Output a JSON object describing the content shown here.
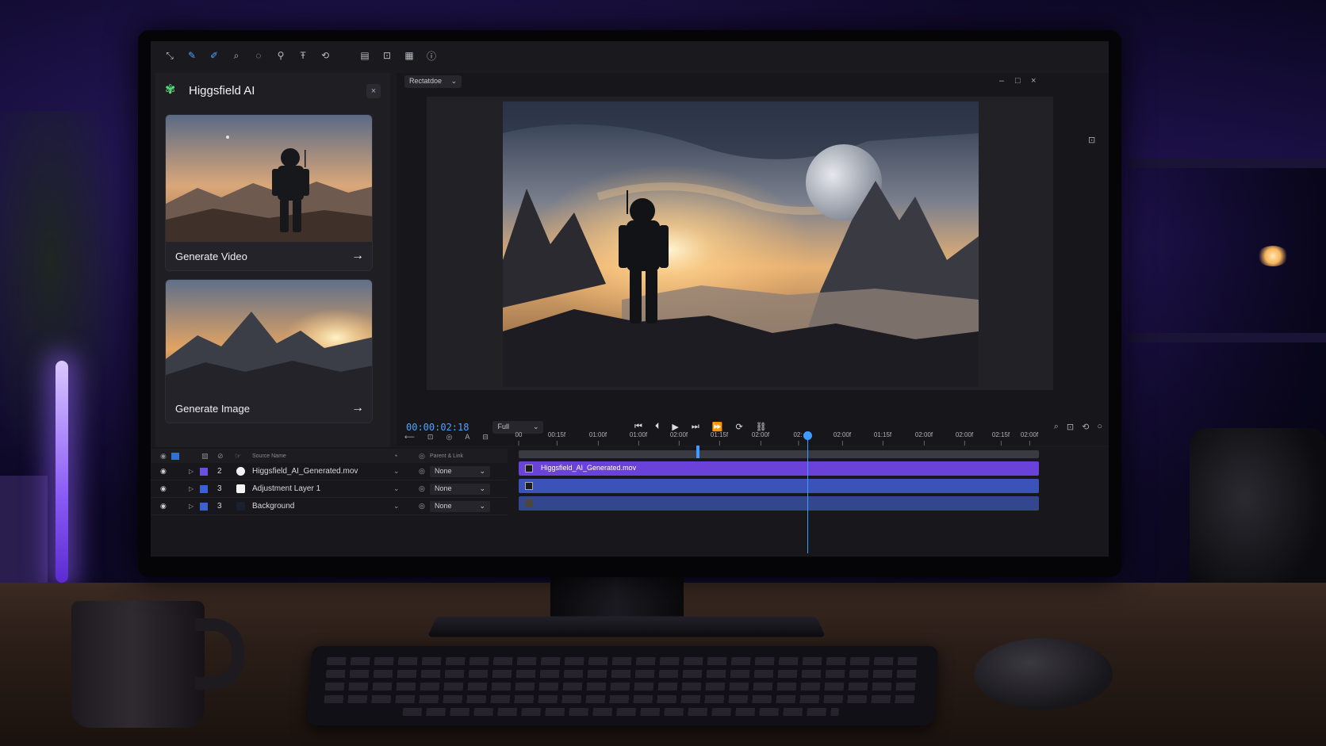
{
  "toolbar": {
    "icons": [
      "selection-tool-icon",
      "pen-tool-icon",
      "brush-tool-icon",
      "zoom-tool-icon",
      "lasso-tool-icon",
      "puppet-tool-icon",
      "text-tool-icon",
      "transform-tool-icon",
      "comment-icon",
      "crop-icon",
      "grid-icon",
      "info-icon"
    ],
    "glyphs": [
      "⤡",
      "✎",
      "✐",
      "⌕",
      "◌",
      "⚲",
      "Ŧ",
      "⟲",
      "▤",
      "⊡",
      "▦",
      "ⓘ"
    ]
  },
  "ai_panel": {
    "title": "Higgsfield AI",
    "close_glyph": "×",
    "cards": [
      {
        "label": "Generate Video",
        "arrow": "→"
      },
      {
        "label": "Generate Image",
        "arrow": "→"
      }
    ]
  },
  "viewer": {
    "composition_name": "Rectatdoe",
    "select_chevron": "⌄",
    "timecode": "00:00:02:18",
    "resolution": "Full",
    "transport_glyphs": [
      "⏮",
      "⏴",
      "▶",
      "⏭",
      "⏩",
      "⟳",
      "⛓"
    ],
    "tool_glyphs": [
      "⌕",
      "⊡",
      "⟲",
      "○"
    ],
    "window_glyphs": [
      "–",
      "□",
      "×"
    ]
  },
  "timeline": {
    "column_source_name": "Source Name",
    "column_parent": "Parent & Link",
    "ruler_ticks": [
      "00:15f",
      "01:00f",
      "01:00f",
      "02:00f",
      "01:15f",
      "02:00f",
      "02:",
      "02:00f",
      "01:15f",
      "02:00f",
      "02:00f",
      "02:15f",
      "02:00f"
    ],
    "start_tick": "00",
    "layers": [
      {
        "num": "2",
        "name": "Higgsfield_AI_Generated.mov",
        "label_color": "#6b4fe0",
        "swatch": "#f2f2f2",
        "parent": "None",
        "track_color": "#6a42d9",
        "track_label": "Higgsfield_AI_Generated.mov"
      },
      {
        "num": "3",
        "name": "Adjustment Layer 1",
        "label_color": "#3d5fd6",
        "swatch": "#f4f4f4",
        "parent": "None",
        "track_color": "#3b52b8",
        "track_label": ""
      },
      {
        "num": "3",
        "name": "Background",
        "label_color": "#3d5fd6",
        "swatch": "#1b2030",
        "parent": "None",
        "track_color": "#33478f",
        "track_label": ""
      }
    ],
    "eye_glyph": "◉",
    "tri_glyph": "▷",
    "switch_glyph": "⌄",
    "parent_icon_glyph": "◎"
  }
}
